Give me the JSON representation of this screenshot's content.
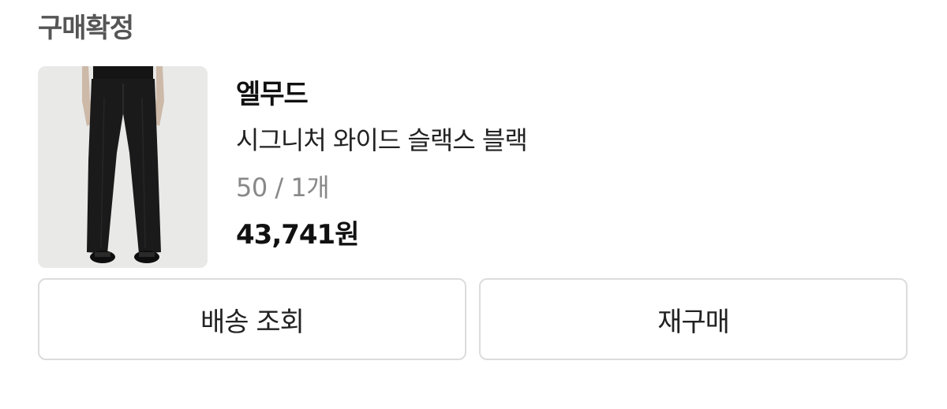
{
  "order": {
    "status": "구매확정"
  },
  "product": {
    "brand": "엘무드",
    "name": "시그니처 와이드 슬랙스 블랙",
    "option": "50 / 1개",
    "price": "43,741원",
    "image_icon": "product-photo-trousers"
  },
  "actions": {
    "track_label": "배송 조회",
    "rebuy_label": "재구매"
  },
  "colors": {
    "thumb_bg": "#e9e9e7",
    "button_border": "#dcdcdc",
    "status_text": "#555555",
    "option_text": "#888888"
  }
}
